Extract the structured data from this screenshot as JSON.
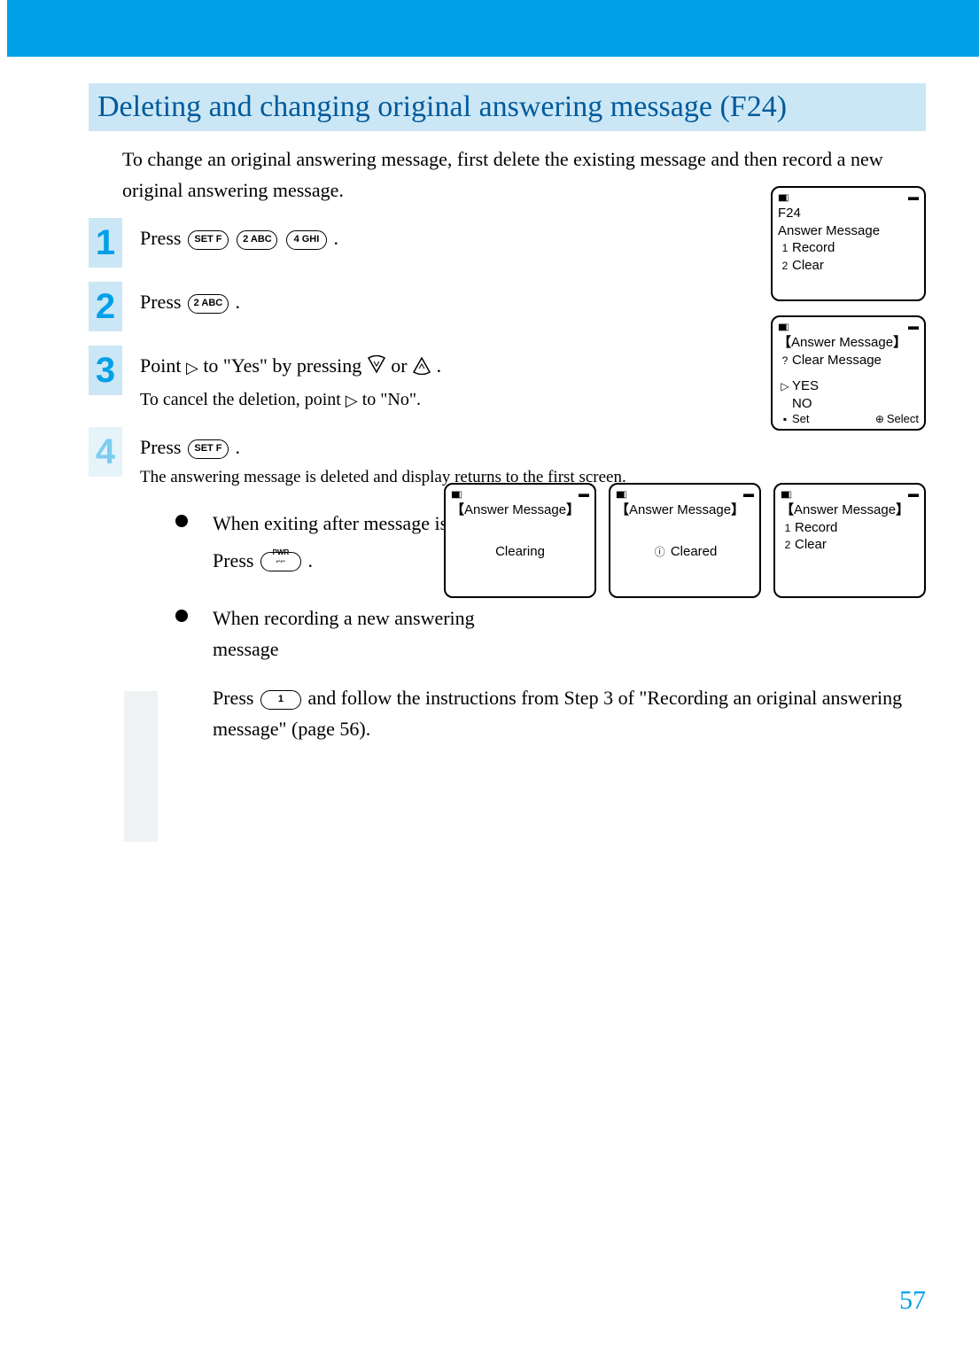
{
  "header": {
    "title": "Deleting and changing original answering message (F24)",
    "intro": "To change an original answering message, first delete the existing message and then record a new original answering message."
  },
  "keys": {
    "set": "SET F",
    "k2": "2 ABC",
    "k4": "4 GHI",
    "k1": "1",
    "pwr_label": "PWR",
    "end_glyph": "⌐⌐"
  },
  "steps": [
    {
      "num": "1",
      "text_pre": "Press ",
      "text_post": "."
    },
    {
      "num": "2",
      "text_pre": "Press ",
      "text_post": "."
    },
    {
      "num": "3",
      "text_pre": "Point ",
      "mid1": " to \"Yes\" by pressing ",
      "mid2": " or ",
      "text_post": ".",
      "sub_pre": "To cancel the deletion, point ",
      "sub_post": " to \"No\"."
    },
    {
      "num": "4",
      "text_pre": "Press ",
      "text_post": ".",
      "sub": "The answering message is deleted and display returns to the first screen."
    }
  ],
  "bullets": {
    "b1_head": "When exiting after message is deleted",
    "b1_sub_pre": "Press ",
    "b1_sub_post": ".",
    "b2_head": "When recording a new answering message",
    "continuation_pre": "Press ",
    "continuation_post": " and follow the instructions from Step 3 of \"Recording an original answering message\" (page 56)."
  },
  "screens": {
    "s1": {
      "l1": "F24",
      "l2": "Answer Message",
      "l3": "Record",
      "l4": "Clear"
    },
    "s2": {
      "l1": "Answer Message",
      "l2": "Clear Message",
      "yes": "YES",
      "no": "NO",
      "set": "Set",
      "select": "Select"
    },
    "s3": {
      "title": "Answer Message",
      "body": "Clearing"
    },
    "s4": {
      "title": "Answer Message",
      "body": "Cleared"
    },
    "s5": {
      "title": "Answer Message",
      "l1": "Record",
      "l2": "Clear"
    }
  },
  "page_number": "57"
}
